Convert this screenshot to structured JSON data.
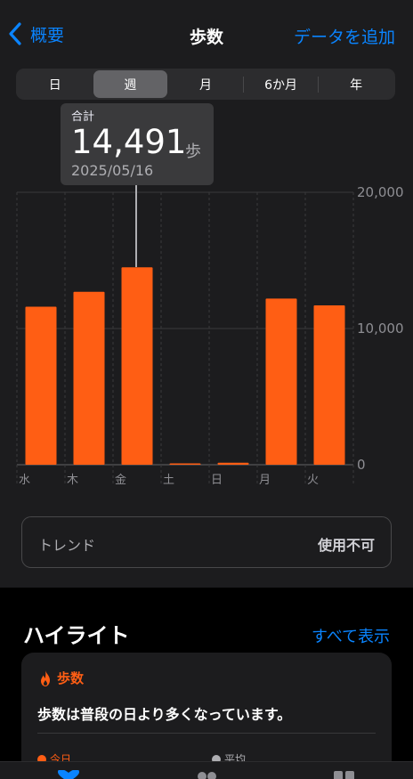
{
  "nav": {
    "back_label": "概要",
    "title": "歩数",
    "add_label": "データを追加"
  },
  "segments": [
    {
      "label": "日",
      "active": false
    },
    {
      "label": "週",
      "active": true
    },
    {
      "label": "月",
      "active": false
    },
    {
      "label": "6か月",
      "active": false
    },
    {
      "label": "年",
      "active": false
    }
  ],
  "tooltip": {
    "label": "合計",
    "value": "14,491",
    "unit": "歩",
    "date": "2025/05/16"
  },
  "chart_data": {
    "type": "bar",
    "categories": [
      "水",
      "木",
      "金",
      "土",
      "日",
      "月",
      "火"
    ],
    "values": [
      11600,
      12700,
      14491,
      50,
      150,
      12200,
      11700
    ],
    "ylim": [
      0,
      20000
    ],
    "y_ticks": [
      "0",
      "10,000",
      "20,000"
    ],
    "y_tick_values": [
      0,
      10000,
      20000
    ],
    "selected_index": 2,
    "bar_color": "#ff5e14",
    "grid": true
  },
  "trend": {
    "label": "トレンド",
    "status": "使用不可"
  },
  "highlights": {
    "title": "ハイライト",
    "show_all": "すべて表示",
    "card": {
      "icon": "flame-icon",
      "category": "歩数",
      "text": "歩数は普段の日より多くなっています。",
      "today_label": "今日",
      "average_label": "平均"
    }
  },
  "colors": {
    "accent": "#0a84ff",
    "steps": "#ff5e14"
  }
}
